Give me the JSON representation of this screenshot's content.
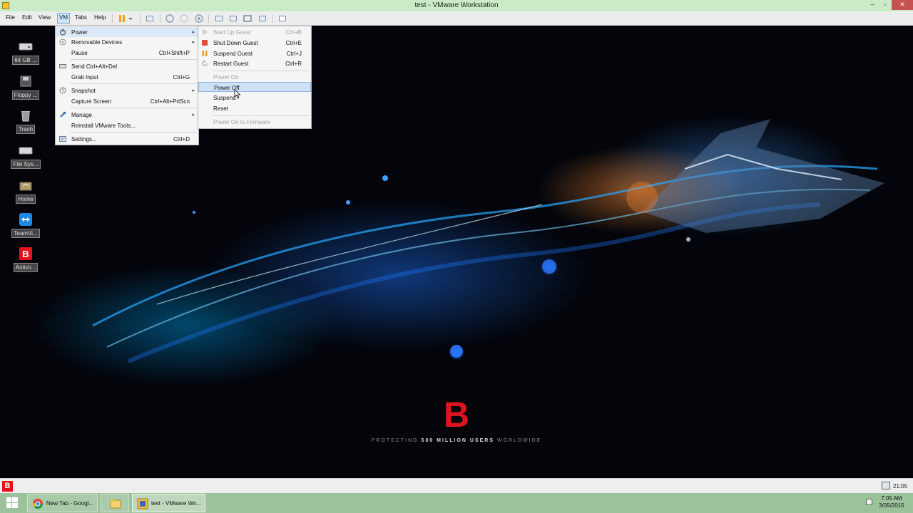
{
  "window": {
    "title": "test - VMware Workstation",
    "controls": {
      "minimize": "–",
      "maximize": "▫",
      "close": "✕"
    }
  },
  "menubar": {
    "file": "File",
    "edit": "Edit",
    "view": "View",
    "vm": "VM",
    "tabs": "Tabs",
    "help": "Help"
  },
  "toolbar": {
    "icons": [
      "pause-icon",
      "dropdown-arrow-icon",
      "send-keys-icon",
      "snapshot-icon",
      "revert-snapshot-icon",
      "snapshot-manager-icon",
      "library-icon",
      "quick-switch-icon",
      "full-screen-icon",
      "unity-icon",
      "console-view-icon"
    ]
  },
  "vm_menu": {
    "items": [
      {
        "label": "Power",
        "shortcut": "",
        "submenu": true,
        "icon": "power-icon"
      },
      {
        "label": "Removable Devices",
        "shortcut": "",
        "submenu": true,
        "icon": "removable-devices-icon"
      },
      {
        "label": "Pause",
        "shortcut": "Ctrl+Shift+P",
        "submenu": false,
        "icon": ""
      },
      {
        "label": "Send Ctrl+Alt+Del",
        "shortcut": "",
        "submenu": false,
        "icon": "keyboard-icon"
      },
      {
        "label": "Grab Input",
        "shortcut": "Ctrl+G",
        "submenu": false,
        "icon": ""
      },
      {
        "label": "Snapshot",
        "shortcut": "",
        "submenu": true,
        "icon": "snapshot-icon"
      },
      {
        "label": "Capture Screen",
        "shortcut": "Ctrl+Alt+PrtScn",
        "submenu": false,
        "icon": ""
      },
      {
        "label": "Manage",
        "shortcut": "",
        "submenu": true,
        "icon": "manage-icon"
      },
      {
        "label": "Reinstall VMware Tools...",
        "shortcut": "",
        "submenu": false,
        "icon": ""
      },
      {
        "label": "Settings...",
        "shortcut": "Ctrl+D",
        "submenu": false,
        "icon": "settings-icon"
      }
    ],
    "highlighted": "Power"
  },
  "power_submenu": {
    "items": [
      {
        "label": "Start Up Guest",
        "shortcut": "Ctrl+B",
        "enabled": false
      },
      {
        "label": "Shut Down Guest",
        "shortcut": "Ctrl+E",
        "enabled": true
      },
      {
        "label": "Suspend Guest",
        "shortcut": "Ctrl+J",
        "enabled": true
      },
      {
        "label": "Restart Guest",
        "shortcut": "Ctrl+R",
        "enabled": true
      },
      {
        "label": "Power On",
        "shortcut": "",
        "enabled": false
      },
      {
        "label": "Power Off",
        "shortcut": "",
        "enabled": true
      },
      {
        "label": "Suspend",
        "shortcut": "",
        "enabled": true
      },
      {
        "label": "Reset",
        "shortcut": "",
        "enabled": true
      },
      {
        "label": "Power On to Firmware",
        "shortcut": "",
        "enabled": false
      }
    ],
    "highlighted": "Power Off"
  },
  "desktop_icons": [
    {
      "label": "64 GB ...",
      "icon": "drive-icon"
    },
    {
      "label": "Floppy ...",
      "icon": "floppy-icon"
    },
    {
      "label": "Trash",
      "icon": "trash-icon"
    },
    {
      "label": "File Sys...",
      "icon": "filesystem-icon"
    },
    {
      "label": "Home",
      "icon": "home-folder-icon"
    },
    {
      "label": "TeamVi...",
      "icon": "teamviewer-icon"
    },
    {
      "label": "Antivir...",
      "icon": "bitdefender-icon"
    }
  ],
  "wallpaper": {
    "logo": "B",
    "tagline_pre": "PROTECTING ",
    "tagline_bold": "500 MILLION USERS",
    "tagline_post": " WORLDWIDE",
    "brand_color": "#e0141e"
  },
  "guest_statusbar": {
    "antivirus_badge": "B",
    "clock": "21:05"
  },
  "host_taskbar": {
    "tasks": [
      {
        "label": "New Tab - Googl...",
        "icon": "chrome-icon"
      },
      {
        "label": "",
        "icon": "file-explorer-icon"
      },
      {
        "label": "test - VMware Wo...",
        "icon": "vmware-icon"
      }
    ],
    "time": "7:05 AM",
    "date": "3/05/2015"
  },
  "colors": {
    "title_bar": "#c9ecc6",
    "menu_highlight": "#dbe8f7",
    "taskbar": "#9bc29a",
    "accent_red": "#e0141e"
  }
}
